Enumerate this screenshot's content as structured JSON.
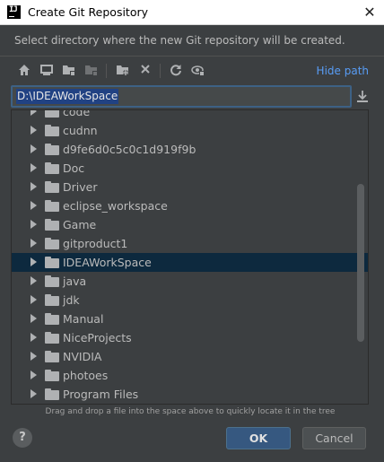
{
  "window": {
    "app_icon_text": "IJ",
    "title": "Create Git Repository",
    "close_symbol": "✕"
  },
  "description": "Select directory where the new Git repository will be created.",
  "toolbar": {
    "icons": [
      "home-icon",
      "desktop-icon",
      "project-folder-icon",
      "module-folder-icon",
      "new-folder-icon",
      "delete-icon",
      "refresh-icon",
      "show-hidden-icon"
    ],
    "hide_path_label": "Hide path"
  },
  "path_field": {
    "value": "D:\\IDEAWorkSpace"
  },
  "tree": {
    "items": [
      {
        "label": "code",
        "selected": false
      },
      {
        "label": "cudnn",
        "selected": false
      },
      {
        "label": "d9fe6d0c5c0c1d919f9b",
        "selected": false
      },
      {
        "label": "Doc",
        "selected": false
      },
      {
        "label": "Driver",
        "selected": false
      },
      {
        "label": "eclipse_workspace",
        "selected": false
      },
      {
        "label": "Game",
        "selected": false
      },
      {
        "label": "gitproduct1",
        "selected": false
      },
      {
        "label": "IDEAWorkSpace",
        "selected": true
      },
      {
        "label": "java",
        "selected": false
      },
      {
        "label": "jdk",
        "selected": false
      },
      {
        "label": "Manual",
        "selected": false
      },
      {
        "label": "NiceProjects",
        "selected": false
      },
      {
        "label": "NVIDIA",
        "selected": false
      },
      {
        "label": "photoes",
        "selected": false
      },
      {
        "label": "Program Files",
        "selected": false
      }
    ]
  },
  "hint": "Drag and drop a file into the space above to quickly locate it in the tree",
  "buttons": {
    "help": "?",
    "ok": "OK",
    "cancel": "Cancel"
  }
}
